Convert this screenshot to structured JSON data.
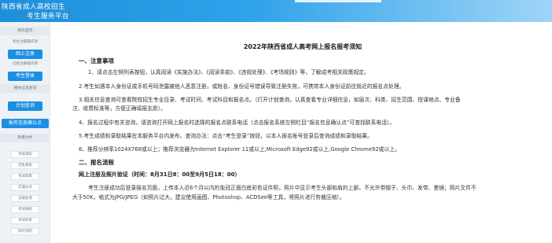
{
  "header": {
    "title_line1": "陕西省成人高校招生",
    "title_line2": "考生服务平台"
  },
  "sidebar": {
    "home": "网页首页",
    "section_register": "考生注册操作项",
    "register_button": "网上注册",
    "section_registered": "已经注册操作项",
    "login_button": "考生登录",
    "section_query": "相关信息查询",
    "plan_button": "计划查询",
    "confirm_button": "报名信息确认点",
    "section_policy": "政策文件",
    "policy_items": [
      "考规须知",
      "招生章程",
      "考试简章",
      "实施办法",
      "违规处理",
      "考试规则",
      "考试科目",
      "照片说明"
    ]
  },
  "notice": {
    "title": "2022年陕西省成人高考网上报名报考须知",
    "section1_title": "一、注意事项",
    "items": [
      "1、请点击左侧列表按钮，认真阅读《实施办法》、《阅读条款》、《违规处理》、《考场规则》等，了解成考相关政策规定。",
      "2.考生如遇本人身份证或手机号码泄露被他人恶意注册，或姓名、身份证号错误导致注册失败，可携带本人身份证前往就近的报名点处理。",
      "3.相关信息查询可查看院校招生专业目录、考试时间、考试科目和报名点。（打开计划查询，认真查看专业详细信息，如层次、科类、招生范围、授课地点、专业备",
      "注、收费标准等，方便正确填报志愿）。",
      "4、报名过程中有关咨询，请咨询打开网上报名时选择的报名点联系电话（点击报名系统左侧栏目“报名信息确认点”可查找联系电话）。",
      "5.考生成绩和录取结果在本服务平台内发布。查询办法：点击“考生登录”按钮，以本人报名账号登录后查询成绩和录取结果。",
      "6、推荐分辨率1024X768或以上；推荐浏览器为Internet Explorer 11或以上,Microsoft Edge92或以上,Google Chrome92或以上。"
    ],
    "section2_title": "二、报名流程",
    "sub_title": "网上注册及照片验证（时间：8月31日8：00至9月5日18：00）",
    "para_line1": "考生注册成功后登录报名页面，上传本人近6个月以内的免冠正面白底彩色证件照，照片中显示考生头部和肩的上部，不允许带帽子、头巾、发带、墨镜；照片文件不",
    "para_line2": "大于50K，格式为JPG/JPEG（如照片过大，建议使用画图、Photoshop、ACDSee等工具，将照片进行剪裁压缩）。"
  },
  "colors": {
    "header_blue": "#1f8fd9",
    "button_blue": "#1a8fe3",
    "sidebar_bg": "#eef2f6"
  }
}
